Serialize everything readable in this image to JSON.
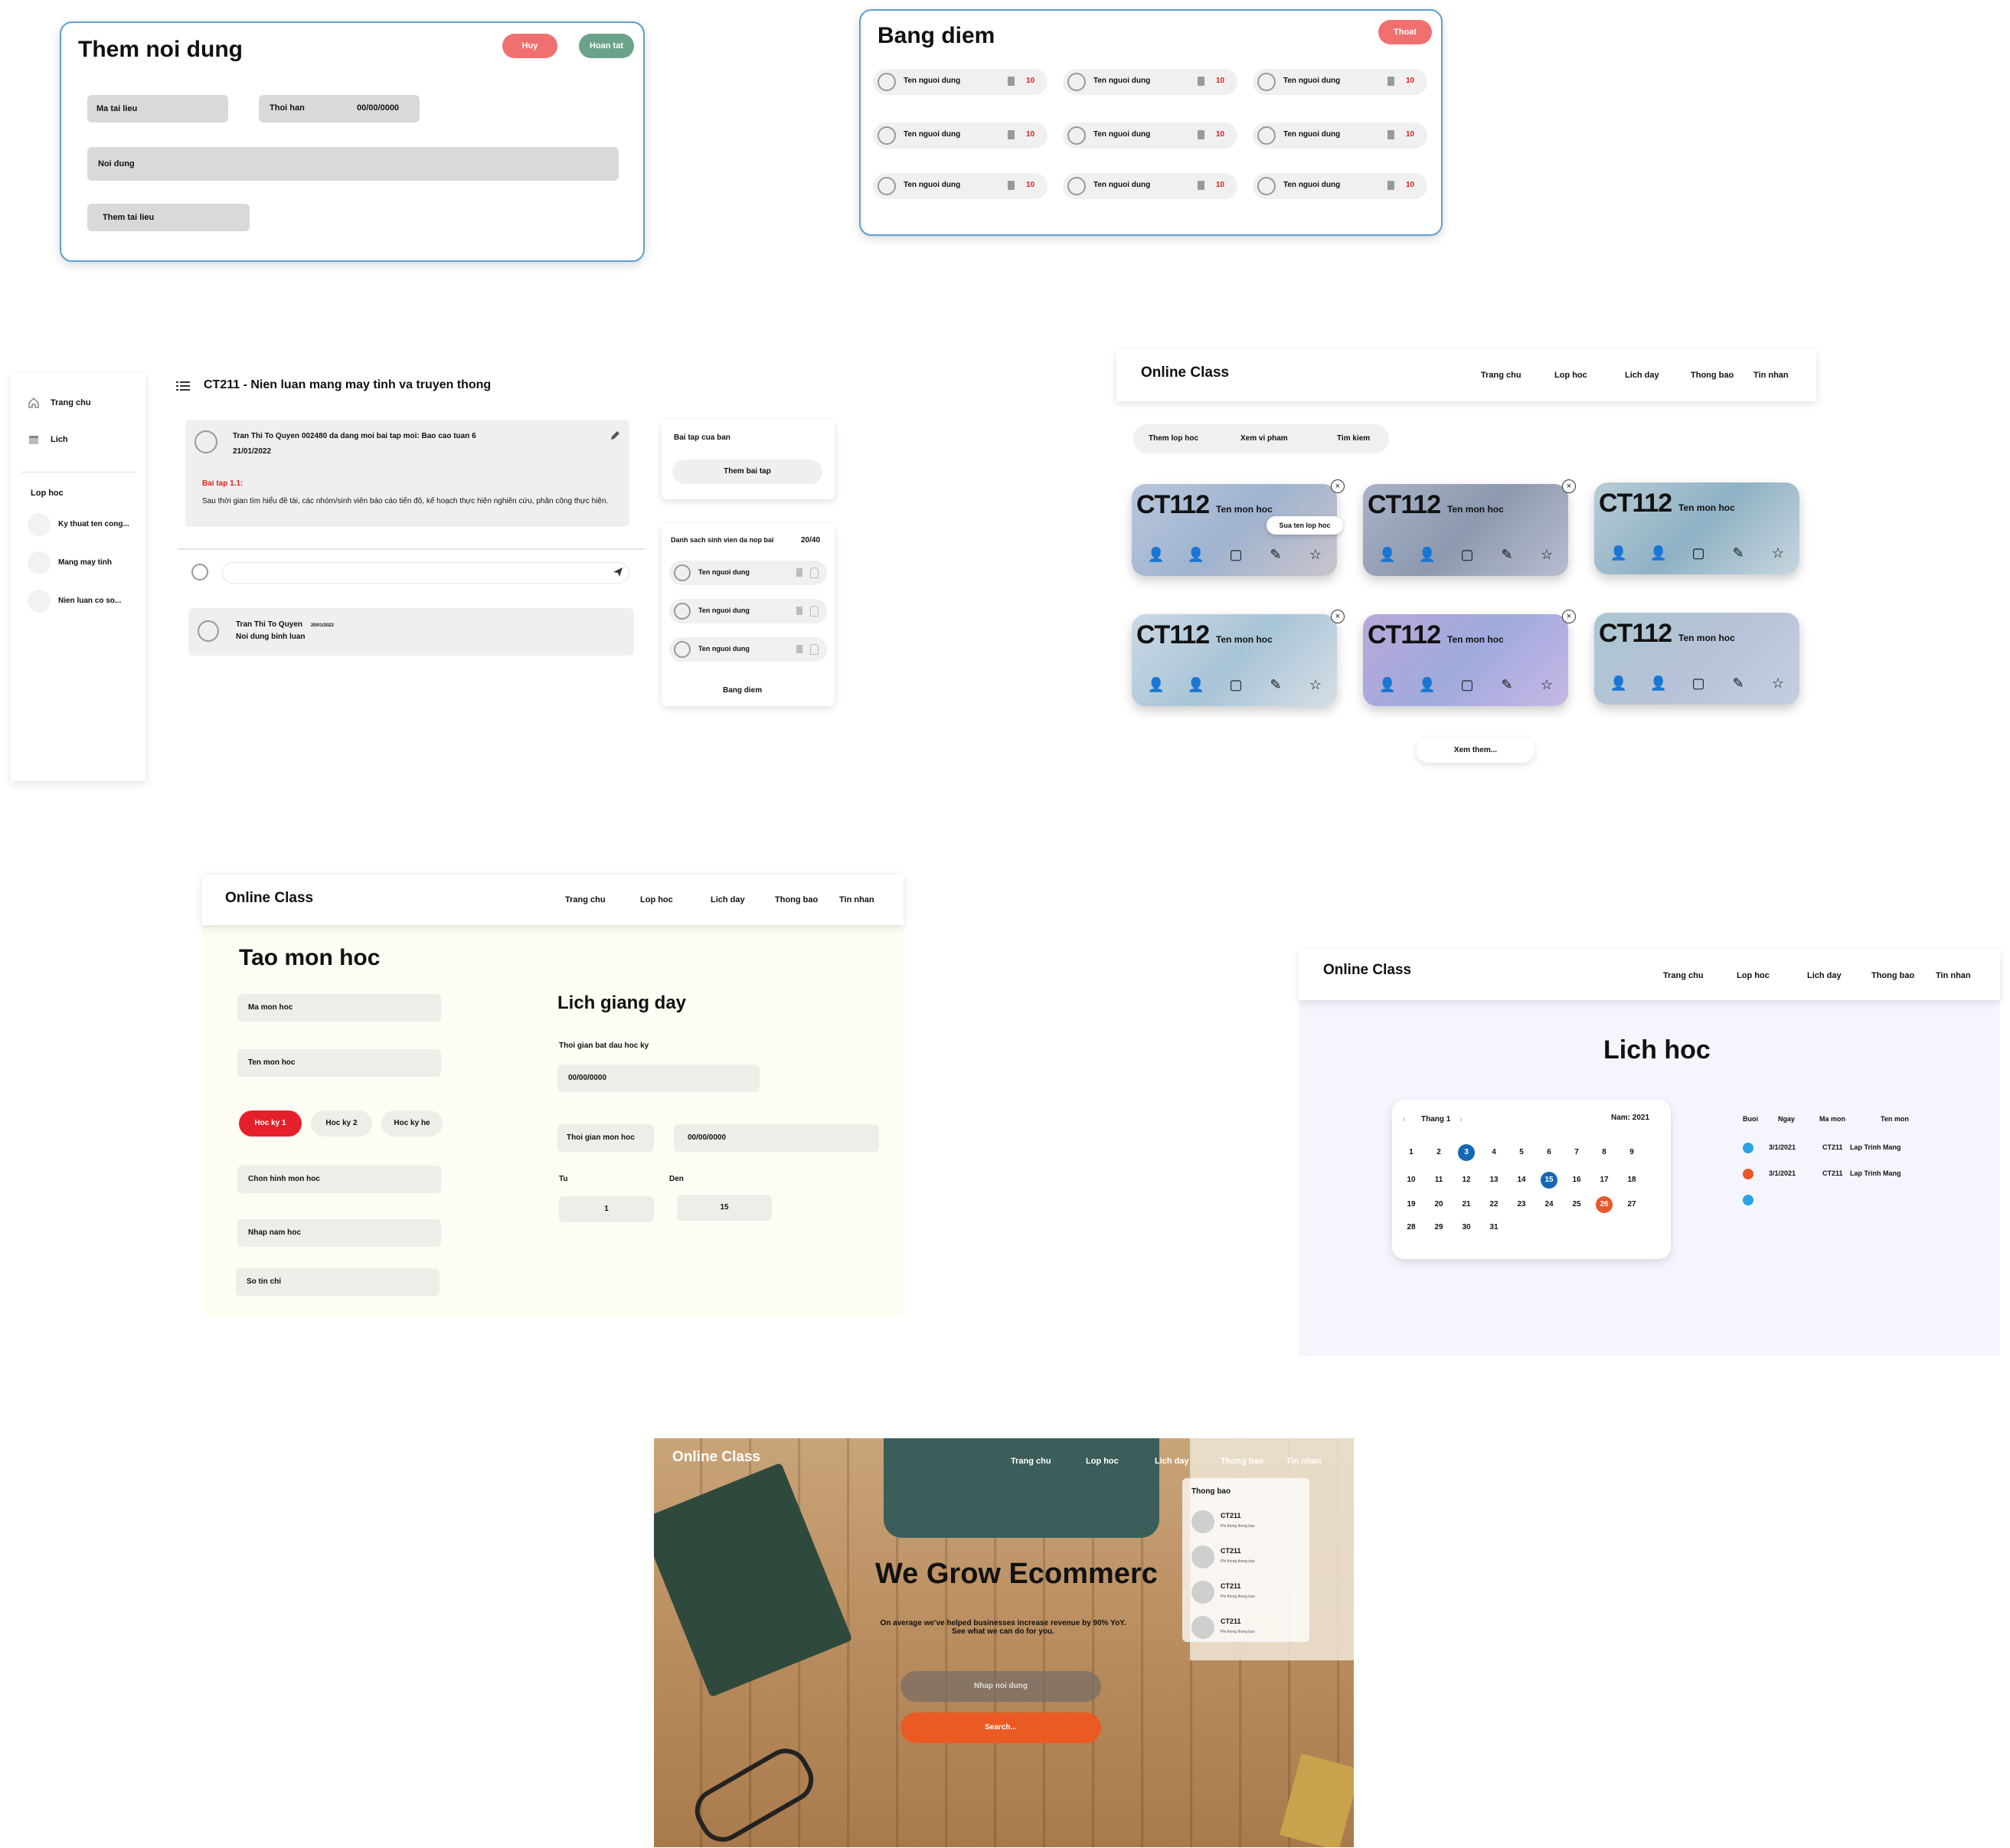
{
  "add_content": {
    "title": "Them noi dung",
    "cancel": "Huy",
    "done": "Hoan tat",
    "doc_code": "Ma tai lieu",
    "deadline_label": "Thoi han",
    "deadline_value": "00/00/0000",
    "content": "Noi dung",
    "add_doc": "Them tai lieu"
  },
  "score_board": {
    "title": "Bang diem",
    "exit": "Thoat",
    "users": [
      {
        "name": "Ten nguoi dung",
        "score": "10"
      },
      {
        "name": "Ten nguoi dung",
        "score": "10"
      },
      {
        "name": "Ten nguoi dung",
        "score": "10"
      },
      {
        "name": "Ten nguoi dung",
        "score": "10"
      },
      {
        "name": "Ten nguoi dung",
        "score": "10"
      },
      {
        "name": "Ten nguoi dung",
        "score": "10"
      },
      {
        "name": "Ten nguoi dung",
        "score": "10"
      },
      {
        "name": "Ten nguoi dung",
        "score": "10"
      },
      {
        "name": "Ten nguoi dung",
        "score": "10"
      }
    ]
  },
  "class_page": {
    "sidebar": {
      "home": "Trang chu",
      "calendar": "Lich",
      "section": "Lop hoc",
      "classes": [
        "Ky thuat ten cong...",
        "Mang may tinh",
        "Nien luan co so..."
      ]
    },
    "course_title": "CT211 - Nien luan mang may tinh va truyen thong",
    "post": {
      "author_line": "Tran Thi To Quyen 002480 da dang moi bai tap moi: Bao cao tuan 6",
      "date": "21/01/2022",
      "assignment": "Bai tap 1.1:",
      "body": "Sau thời gian tìm hiểu đề tài, các nhóm/sinh viên báo cáo tiến độ, kế hoạch thực hiện nghiên cứu, phân công thực hiện."
    },
    "comment": {
      "author": "Tran Thi To Quyen",
      "time": "20/01/2022",
      "text": "Noi dung binh luan"
    },
    "your_work": "Bai tap cua ban",
    "add_work": "Them bai tap",
    "submitted_title": "Danh sach sinh vien da nop bai",
    "submitted_count": "20/40",
    "submitted": [
      "Ten nguoi dung",
      "Ten nguoi dung",
      "Ten nguoi dung"
    ],
    "score_link": "Bang diem"
  },
  "class_list": {
    "brand": "Online Class",
    "nav": [
      "Trang chu",
      "Lop hoc",
      "Lich day",
      "Thong bao",
      "Tin nhan"
    ],
    "tabs": [
      "Them lop hoc",
      "Xem vi pham",
      "Tim kiem"
    ],
    "tooltip": "Sua ten lop hoc",
    "cards": [
      {
        "code": "CT112",
        "name": "Ten mon hoc"
      },
      {
        "code": "CT112",
        "name": "Ten mon hoc"
      },
      {
        "code": "CT112",
        "name": "Ten mon hoc"
      },
      {
        "code": "CT112",
        "name": "Ten mon hoc"
      },
      {
        "code": "CT112",
        "name": "Ten mon hoc"
      },
      {
        "code": "CT112",
        "name": "Ten mon hoc"
      }
    ],
    "more": "Xem them..."
  },
  "create_course": {
    "brand": "Online Class",
    "nav": [
      "Trang chu",
      "Lop hoc",
      "Lich day",
      "Thong bao",
      "Tin nhan"
    ],
    "title": "Tao mon hoc",
    "course_code": "Ma mon hoc",
    "course_name": "Ten mon hoc",
    "semesters": [
      "Hoc ky 1",
      "Hoc ky 2",
      "Hoc ky he"
    ],
    "form": "Chon hinh mon hoc",
    "year": "Nhap nam hoc",
    "credits": "So tin chi",
    "schedule_title": "Lich giang day",
    "start_label": "Thoi gian bat dau hoc ky",
    "start_value": "00/00/0000",
    "time_label": "Thoi gian mon hoc",
    "time_value": "00/00/0000",
    "from_label": "Tu",
    "to_label": "Den",
    "from_value": "1",
    "to_value": "15"
  },
  "calendar_page": {
    "brand": "Online Class",
    "nav": [
      "Trang chu",
      "Lop hoc",
      "Lich day",
      "Thong bao",
      "Tin nhan"
    ],
    "title": "Lich hoc",
    "month": "Thang 1",
    "year": "Nam: 2021",
    "days": [
      "1",
      "2",
      "3",
      "4",
      "5",
      "6",
      "7",
      "8",
      "9",
      "10",
      "11",
      "12",
      "13",
      "14",
      "15",
      "16",
      "17",
      "18",
      "19",
      "20",
      "21",
      "22",
      "23",
      "24",
      "25",
      "26",
      "27",
      "28",
      "29",
      "30",
      "31"
    ],
    "highlight_blue": [
      "3",
      "15"
    ],
    "highlight_orange": [
      "26"
    ],
    "table_headers": [
      "Buoi",
      "Ngay",
      "Ma mon",
      "Ten mon"
    ],
    "rows": [
      {
        "color": "#2aa3e0",
        "date": "3/1/2021",
        "code": "CT211",
        "name": "Lap Trinh Mang"
      },
      {
        "color": "#e8572a",
        "date": "3/1/2021",
        "code": "CT211",
        "name": "Lap Trinh Mang"
      },
      {
        "color": "#2aa3e0",
        "date": "",
        "code": "",
        "name": ""
      }
    ]
  },
  "landing": {
    "brand": "Online Class",
    "nav": [
      "Trang chu",
      "Lop hoc",
      "Lich day",
      "Thong bao",
      "Tin nhan"
    ],
    "headline": "We Grow Ecommerc",
    "sub1": "On average we've helped businesses increase revenue by 90% YoY.",
    "sub2": "See what we can do for you.",
    "input_placeholder": "Nhap noi dung",
    "search": "Search...",
    "notif_title": "Thong bao",
    "notifs": [
      {
        "code": "CT211",
        "text": "Phi thong thong bao"
      },
      {
        "code": "CT211",
        "text": "Phi thong thong bao"
      },
      {
        "code": "CT211",
        "text": "Phi thong thong bao"
      },
      {
        "code": "CT211",
        "text": "Phi thong thong bao"
      }
    ]
  }
}
